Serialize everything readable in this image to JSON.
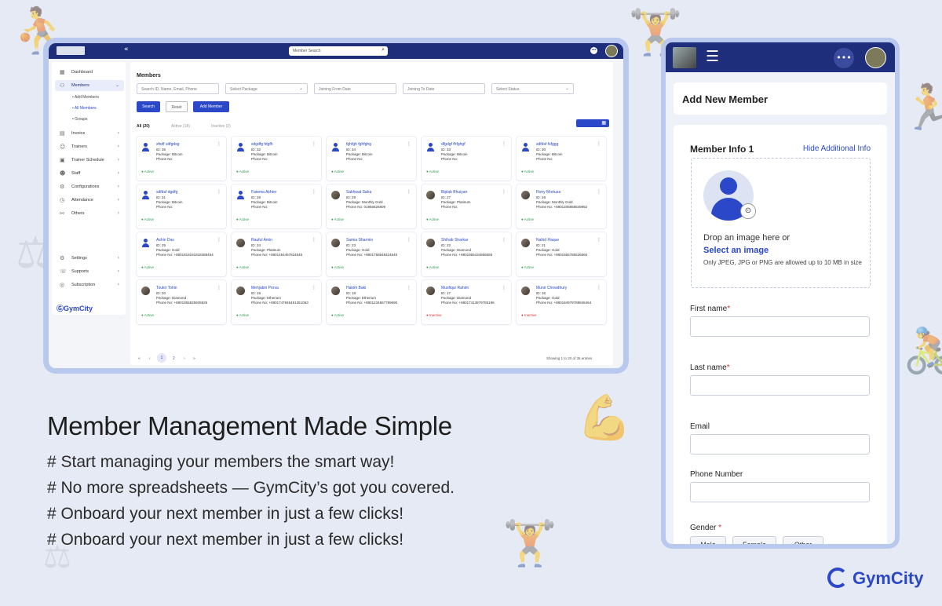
{
  "colors": {
    "primary": "#1e2e7a",
    "accent": "#2a48c8",
    "active": "#2a9a4a",
    "inactive": "#dd3333",
    "background": "#e6eaf4"
  },
  "desktop": {
    "search_placeholder": "Member Search",
    "sidebar": {
      "items": [
        {
          "label": "Dashboard",
          "icon": "dashboard-icon"
        },
        {
          "label": "Members",
          "icon": "members-icon"
        },
        {
          "label": "Invoice",
          "icon": "invoice-icon"
        },
        {
          "label": "Trainers",
          "icon": "trainers-icon"
        },
        {
          "label": "Trainer Schedule",
          "icon": "schedule-icon"
        },
        {
          "label": "Staff",
          "icon": "staff-icon"
        },
        {
          "label": "Configurations",
          "icon": "config-icon"
        },
        {
          "label": "Attendance",
          "icon": "attendance-icon"
        },
        {
          "label": "Others",
          "icon": "others-icon"
        },
        {
          "label": "Settings",
          "icon": "settings-icon"
        },
        {
          "label": "Supports",
          "icon": "supports-icon"
        },
        {
          "label": "Subscription",
          "icon": "subscription-icon"
        }
      ],
      "sub_items": [
        "Add Members",
        "All Members",
        "Groups"
      ],
      "brand": "GymCity"
    },
    "main": {
      "title": "Members",
      "filters": {
        "search": "Search ID, Name, Email, Phone",
        "package": "Select Package",
        "join_from": "Joining From Date",
        "join_to": "Joining To Date",
        "status": "Select Status"
      },
      "buttons": {
        "search": "Search",
        "reset": "Reset",
        "add": "Add Member"
      },
      "tabs": [
        "All (20)",
        "Active (18)",
        "Inactive (2)"
      ],
      "members": [
        {
          "name": "sfsdf sdfgdsg",
          "id": "ID: 35",
          "package": "Package: Bitcoin",
          "phone": "Phone No:",
          "status": "Active",
          "avatar": "default"
        },
        {
          "name": "sdgdfg fdgfh",
          "id": "ID: 32",
          "package": "Package: Bitcoin",
          "phone": "Phone No:",
          "status": "Active",
          "avatar": "default"
        },
        {
          "name": "fghfgh fghfghg",
          "id": "ID: 34",
          "package": "Package: Bitcoin",
          "phone": "Phone No:",
          "status": "Active",
          "avatar": "default"
        },
        {
          "name": "dfgdgf fhfghgf",
          "id": "ID: 33",
          "package": "Package: Bitcoin",
          "phone": "Phone No:",
          "status": "Active",
          "avatar": "default"
        },
        {
          "name": "sdfdsf fsfggg",
          "id": "ID: 30",
          "package": "Package: Bitcoin",
          "phone": "Phone No:",
          "status": "Active",
          "avatar": "default"
        },
        {
          "name": "sdfdsf dgdfg",
          "id": "ID: 31",
          "package": "Package: Bitcoin",
          "phone": "Phone No:",
          "status": "Active",
          "avatar": "default"
        },
        {
          "name": "Fatema Akhter",
          "id": "ID: 28",
          "package": "Package: Bitcoin",
          "phone": "Phone No:",
          "status": "Active",
          "avatar": "default"
        },
        {
          "name": "Sakhwat Saha",
          "id": "ID: 29",
          "package": "Package: Monthly Gold",
          "phone": "Phone No: 01956826809",
          "status": "Active",
          "avatar": "photo"
        },
        {
          "name": "Biplab Bhuiyan",
          "id": "ID: 27",
          "package": "Package: Platinum",
          "phone": "Phone No:",
          "status": "Active",
          "avatar": "photo"
        },
        {
          "name": "Rony Mortuza",
          "id": "ID: 26",
          "package": "Package: Monthly Gold",
          "phone": "Phone No: +8801205858549852",
          "status": "Active",
          "avatar": "photo"
        },
        {
          "name": "Ashin Das",
          "id": "ID: 25",
          "package": "Package: Gold",
          "phone": "Phone No: +8801818181818488454",
          "status": "Active",
          "avatar": "default"
        },
        {
          "name": "Rauful Amin",
          "id": "ID: 24",
          "package": "Package: Platinum",
          "phone": "Phone No: +8801454457824545",
          "status": "Active",
          "avatar": "photo"
        },
        {
          "name": "Samia Sharmin",
          "id": "ID: 23",
          "package": "Package: Gold",
          "phone": "Phone No: +8801758548424545",
          "status": "Active",
          "avatar": "photo"
        },
        {
          "name": "Shihab Sharkar",
          "id": "ID: 22",
          "package": "Package: Diamond",
          "phone": "Phone No: +8801955434956555",
          "status": "Active",
          "avatar": "photo"
        },
        {
          "name": "Nahid Haque",
          "id": "ID: 21",
          "package": "Package: Gold",
          "phone": "Phone No: +8801565785526565",
          "status": "Active",
          "avatar": "photo"
        },
        {
          "name": "Toukir Tohin",
          "id": "ID: 20",
          "package": "Package: Diamond",
          "phone": "Phone No: +8801855835935925",
          "status": "Active",
          "avatar": "photo"
        },
        {
          "name": "Mehjabin Prova",
          "id": "ID: 19",
          "package": "Package: Etherium",
          "phone": "Phone No: +8801747845451351063",
          "status": "Active",
          "avatar": "photo"
        },
        {
          "name": "Hakim Baki",
          "id": "ID: 18",
          "package": "Package: Etherium",
          "phone": "Phone No: +8801234567789690",
          "status": "Active",
          "avatar": "photo"
        },
        {
          "name": "Musfiqur Rahim",
          "id": "ID: 17",
          "package": "Package: Diamond",
          "phone": "Phone No: +8801741387978519​6",
          "status": "Inactive",
          "avatar": "photo"
        },
        {
          "name": "Munir Chowdhury",
          "id": "ID: 16",
          "package": "Package: Gold",
          "phone": "Phone No: +8801849797888464​64",
          "status": "Inactive",
          "avatar": "photo"
        }
      ],
      "pagination": {
        "first": "«",
        "prev": "‹",
        "pages": [
          "1",
          "2"
        ],
        "next": "›",
        "last": "»",
        "showing": "Showing 1 to 20 of 35 entries"
      }
    }
  },
  "headline": "Member Management Made Simple",
  "bullets": [
    "# Start managing your members the smart way!",
    "# No more spreadsheets — GymCity’s got you covered.",
    "# Onboard your next member in just a few clicks!",
    "# Onboard your next member in just a few clicks!"
  ],
  "mobile": {
    "page_title": "Add New Member",
    "section_title": "Member Info 1",
    "hide_link": "Hide Additional Info",
    "drop_text": "Drop an image here or",
    "select_link": "Select an image",
    "note": "Only JPEG, JPG or PNG are allowed up to 10 MB in size",
    "fields": {
      "first_name": "First name",
      "last_name": "Last name",
      "email": "Email",
      "phone": "Phone Number",
      "gender": "Gender",
      "required_mark": "*"
    },
    "gender_options": [
      "Male",
      "Female",
      "Other"
    ]
  },
  "brand": "GymCity"
}
